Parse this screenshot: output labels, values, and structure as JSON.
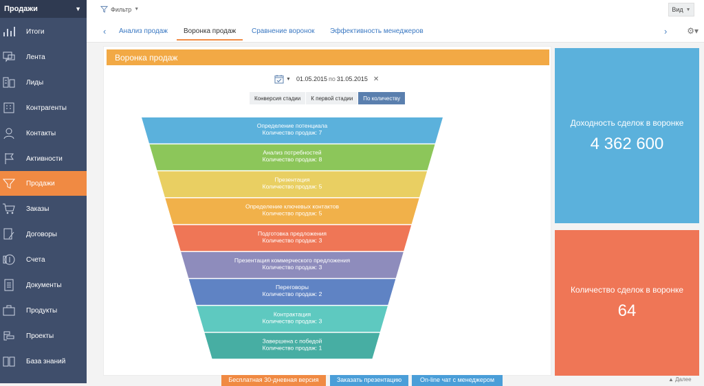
{
  "sidebar": {
    "title": "Продажи",
    "items": [
      {
        "label": "Итоги",
        "icon": "bar-chart-icon",
        "active": false
      },
      {
        "label": "Лента",
        "icon": "chat-icon",
        "active": false
      },
      {
        "label": "Лиды",
        "icon": "leads-icon",
        "active": false
      },
      {
        "label": "Контрагенты",
        "icon": "building-icon",
        "active": false
      },
      {
        "label": "Контакты",
        "icon": "person-icon",
        "active": false
      },
      {
        "label": "Активности",
        "icon": "flag-icon",
        "active": false
      },
      {
        "label": "Продажи",
        "icon": "funnel-icon",
        "active": true
      },
      {
        "label": "Заказы",
        "icon": "cart-icon",
        "active": false
      },
      {
        "label": "Договоры",
        "icon": "contract-icon",
        "active": false
      },
      {
        "label": "Счета",
        "icon": "invoice-icon",
        "active": false
      },
      {
        "label": "Документы",
        "icon": "document-icon",
        "active": false
      },
      {
        "label": "Продукты",
        "icon": "box-icon",
        "active": false
      },
      {
        "label": "Проекты",
        "icon": "projects-icon",
        "active": false
      },
      {
        "label": "База знаний",
        "icon": "book-icon",
        "active": false
      }
    ]
  },
  "topbar": {
    "filter_label": "Фильтр",
    "view_label": "Вид"
  },
  "tabs": [
    {
      "label": "Анализ продаж",
      "active": false
    },
    {
      "label": "Воронка продаж",
      "active": true
    },
    {
      "label": "Сравнение воронок",
      "active": false
    },
    {
      "label": "Эффективность менеджеров",
      "active": false
    }
  ],
  "panel": {
    "title": "Воронка продаж",
    "date_from": "01.05.2015",
    "date_sep": "по",
    "date_to": "31.05.2015",
    "modes": [
      {
        "label": "Конверсия стадии",
        "active": false
      },
      {
        "label": "К первой стадии",
        "active": false
      },
      {
        "label": "По количеству",
        "active": true
      }
    ]
  },
  "funnel": {
    "stages": [
      {
        "name": "Определение потенциала",
        "value_text": "Количество продаж: 7",
        "color": "#5bb1dc"
      },
      {
        "name": "Анализ потребностей",
        "value_text": "Количество продаж: 8",
        "color": "#8cc65a"
      },
      {
        "name": "Презентация",
        "value_text": "Количество продаж: 5",
        "color": "#e9cf62"
      },
      {
        "name": "Определение ключевых контактов",
        "value_text": "Количество продаж: 5",
        "color": "#f1b14a"
      },
      {
        "name": "Подготовка предложения",
        "value_text": "Количество продаж: 3",
        "color": "#ef7656"
      },
      {
        "name": "Презентация коммерческого предложения",
        "value_text": "Количество продаж: 3",
        "color": "#8e8cbc"
      },
      {
        "name": "Переговоры",
        "value_text": "Количество продаж: 2",
        "color": "#5f83c4"
      },
      {
        "name": "Контрактация",
        "value_text": "Количество продаж: 3",
        "color": "#5ec9c0"
      },
      {
        "name": "Завершена с победой",
        "value_text": "Количество продаж: 1",
        "color": "#47aea3"
      }
    ]
  },
  "kpis": [
    {
      "title": "Доходность сделок в воронке",
      "value": "4 362 600",
      "color": "#5bb1dc"
    },
    {
      "title": "Количество сделок в воронке",
      "value": "64",
      "color": "#ef7656"
    }
  ],
  "bottom": {
    "trial_label": "Бесплатная 30-дневная версия",
    "order_label": "Заказать презентацию",
    "chat_label": "On-line чат с менеджером",
    "more_label": "Далее"
  }
}
